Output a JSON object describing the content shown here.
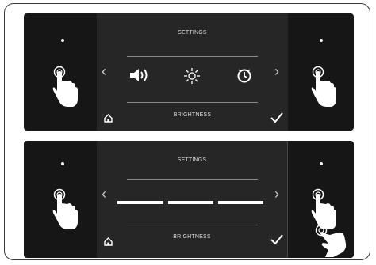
{
  "panels": [
    {
      "header": "SETTINGS",
      "footer": "BRIGHTNESS",
      "left_arrow": "‹",
      "right_arrow": "›",
      "icons": [
        "home-icon",
        "speaker-icon",
        "brightness-icon",
        "clock-icon",
        "checkmark-icon",
        "tap-hand-icon"
      ]
    },
    {
      "header": "SETTINGS",
      "footer": "BRIGHTNESS",
      "left_arrow": "‹",
      "right_arrow": "›",
      "icons": [
        "home-icon",
        "brightness-level-bar-icon",
        "checkmark-icon",
        "tap-hand-icon",
        "swipe-hand-icon"
      ]
    }
  ],
  "colors": {
    "panel": "#161616",
    "screen": "#262626",
    "text": "#d8d8d8"
  }
}
